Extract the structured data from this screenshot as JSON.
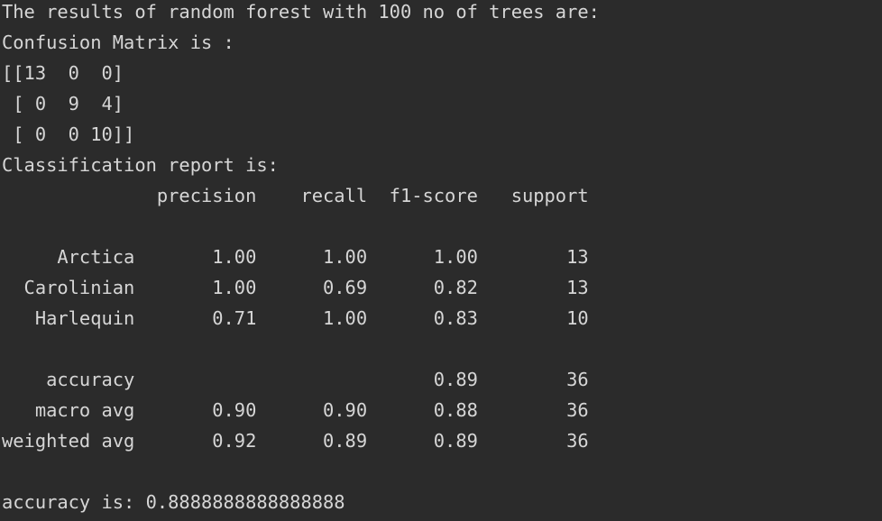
{
  "console": {
    "lines": [
      "The results of random forest with 100 no of trees are:",
      "Confusion Matrix is :",
      "[[13  0  0]",
      " [ 0  9  4]",
      " [ 0  0 10]]",
      "Classification report is:",
      "              precision    recall  f1-score   support",
      "",
      "     Arctica       1.00      1.00      1.00        13",
      "  Carolinian       1.00      0.69      0.82        13",
      "   Harlequin       0.71      1.00      0.83        10",
      "",
      "    accuracy                           0.89        36",
      "   macro avg       0.90      0.90      0.88        36",
      "weighted avg       0.92      0.89      0.89        36",
      "",
      "accuracy is: 0.8888888888888888"
    ]
  }
}
